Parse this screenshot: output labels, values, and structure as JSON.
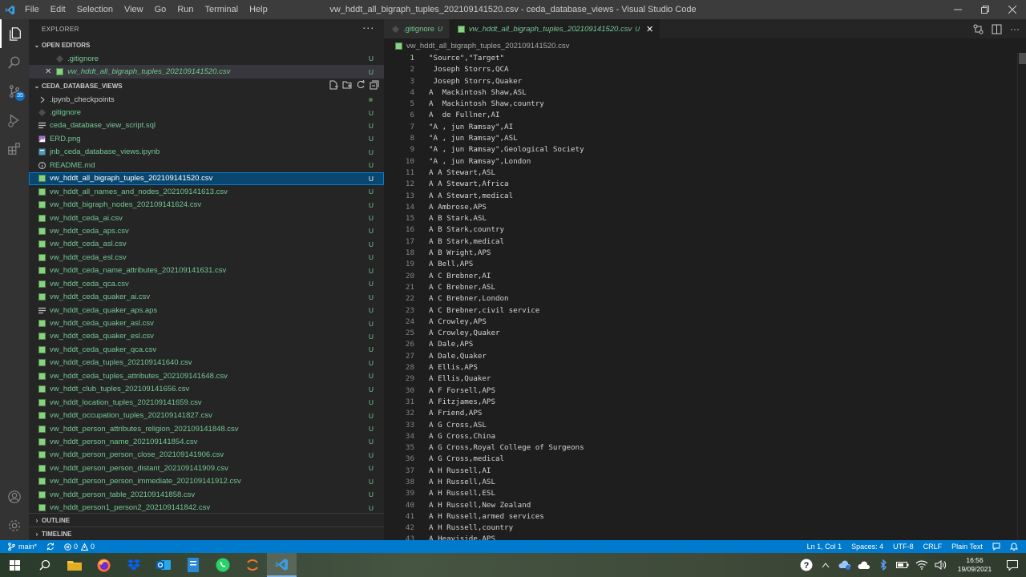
{
  "window": {
    "title": "vw_hddt_all_bigraph_tuples_202109141520.csv - ceda_database_views - Visual Studio Code"
  },
  "menu": [
    "File",
    "Edit",
    "Selection",
    "View",
    "Go",
    "Run",
    "Terminal",
    "Help"
  ],
  "activity_bar": {
    "source_control_badge": "35"
  },
  "explorer": {
    "header": "EXPLORER",
    "more": "···",
    "open_editors_label": "OPEN EDITORS",
    "open_editors": [
      {
        "name": ".gitignore",
        "status": "U"
      },
      {
        "name": "vw_hddt_all_bigraph_tuples_202109141520.csv",
        "status": "U"
      }
    ],
    "folder_label": "CEDA_DATABASE_VIEWS",
    "files": [
      {
        "name": ".ipynb_checkpoints",
        "status": "",
        "kind": "folder"
      },
      {
        "name": ".gitignore",
        "status": "U",
        "kind": "git"
      },
      {
        "name": "ceda_database_view_script.sql",
        "status": "U",
        "kind": "lines"
      },
      {
        "name": "ERD.png",
        "status": "U",
        "kind": "image"
      },
      {
        "name": "jnb_ceda_database_views.ipynb",
        "status": "U",
        "kind": "notebook"
      },
      {
        "name": "README.md",
        "status": "U",
        "kind": "info"
      },
      {
        "name": "vw_hddt_all_bigraph_tuples_202109141520.csv",
        "status": "U",
        "kind": "csv"
      },
      {
        "name": "vw_hddt_all_names_and_nodes_202109141613.csv",
        "status": "U",
        "kind": "csv"
      },
      {
        "name": "vw_hddt_bigraph_nodes_202109141624.csv",
        "status": "U",
        "kind": "csv"
      },
      {
        "name": "vw_hddt_ceda_ai.csv",
        "status": "U",
        "kind": "csv"
      },
      {
        "name": "vw_hddt_ceda_aps.csv",
        "status": "U",
        "kind": "csv"
      },
      {
        "name": "vw_hddt_ceda_asl.csv",
        "status": "U",
        "kind": "csv"
      },
      {
        "name": "vw_hddt_ceda_esl.csv",
        "status": "U",
        "kind": "csv"
      },
      {
        "name": "vw_hddt_ceda_name_attributes_202109141631.csv",
        "status": "U",
        "kind": "csv"
      },
      {
        "name": "vw_hddt_ceda_qca.csv",
        "status": "U",
        "kind": "csv"
      },
      {
        "name": "vw_hddt_ceda_quaker_ai.csv",
        "status": "U",
        "kind": "csv"
      },
      {
        "name": "vw_hddt_ceda_quaker_aps.aps",
        "status": "U",
        "kind": "lines"
      },
      {
        "name": "vw_hddt_ceda_quaker_asl.csv",
        "status": "U",
        "kind": "csv"
      },
      {
        "name": "vw_hddt_ceda_quaker_esl.csv",
        "status": "U",
        "kind": "csv"
      },
      {
        "name": "vw_hddt_ceda_quaker_qca.csv",
        "status": "U",
        "kind": "csv"
      },
      {
        "name": "vw_hddt_ceda_tuples_202109141640.csv",
        "status": "U",
        "kind": "csv"
      },
      {
        "name": "vw_hddt_ceda_tuples_attributes_202109141648.csv",
        "status": "U",
        "kind": "csv"
      },
      {
        "name": "vw_hddt_club_tuples_202109141656.csv",
        "status": "U",
        "kind": "csv"
      },
      {
        "name": "vw_hddt_location_tuples_202109141659.csv",
        "status": "U",
        "kind": "csv"
      },
      {
        "name": "vw_hddt_occupation_tuples_202109141827.csv",
        "status": "U",
        "kind": "csv"
      },
      {
        "name": "vw_hddt_person_attributes_religion_202109141848.csv",
        "status": "U",
        "kind": "csv"
      },
      {
        "name": "vw_hddt_person_name_202109141854.csv",
        "status": "U",
        "kind": "csv"
      },
      {
        "name": "vw_hddt_person_person_close_202109141906.csv",
        "status": "U",
        "kind": "csv"
      },
      {
        "name": "vw_hddt_person_person_distant_202109141909.csv",
        "status": "U",
        "kind": "csv"
      },
      {
        "name": "vw_hddt_person_person_immediate_202109141912.csv",
        "status": "U",
        "kind": "csv"
      },
      {
        "name": "vw_hddt_person_table_202109141858.csv",
        "status": "U",
        "kind": "csv"
      },
      {
        "name": "vw_hddt_person1_person2_202109141842.csv",
        "status": "U",
        "kind": "csv"
      }
    ],
    "outline_label": "OUTLINE",
    "timeline_label": "TIMELINE"
  },
  "tabs": [
    {
      "name": ".gitignore",
      "status": "U"
    },
    {
      "name": "vw_hddt_all_bigraph_tuples_202109141520.csv",
      "status": "U"
    }
  ],
  "breadcrumb": "vw_hddt_all_bigraph_tuples_202109141520.csv",
  "code_lines": [
    "\"Source\",\"Target\"",
    " Joseph Storrs,QCA",
    " Joseph Storrs,Quaker",
    "A  Mackintosh Shaw,ASL",
    "A  Mackintosh Shaw,country",
    "A  de Fullner,AI",
    "\"A , jun Ramsay\",AI",
    "\"A , jun Ramsay\",ASL",
    "\"A , jun Ramsay\",Geological Society",
    "\"A , jun Ramsay\",London",
    "A A Stewart,ASL",
    "A A Stewart,Africa",
    "A A Stewart,medical",
    "A Ambrose,APS",
    "A B Stark,ASL",
    "A B Stark,country",
    "A B Stark,medical",
    "A B Wright,APS",
    "A Bell,APS",
    "A C Brebner,AI",
    "A C Brebner,ASL",
    "A C Brebner,London",
    "A C Brebner,civil service",
    "A Crowley,APS",
    "A Crowley,Quaker",
    "A Dale,APS",
    "A Dale,Quaker",
    "A Ellis,APS",
    "A Ellis,Quaker",
    "A F Forsell,APS",
    "A Fitzjames,APS",
    "A Friend,APS",
    "A G Cross,ASL",
    "A G Cross,China",
    "A G Cross,Royal College of Surgeons",
    "A G Cross,medical",
    "A H Russell,AI",
    "A H Russell,ASL",
    "A H Russell,ESL",
    "A H Russell,New Zealand",
    "A H Russell,armed services",
    "A H Russell,country",
    "A Heaviside,APS"
  ],
  "status_bar": {
    "branch": "main*",
    "errors": "0",
    "warnings": "0",
    "position": "Ln 1, Col 1",
    "spaces": "Spaces: 4",
    "encoding": "UTF-8",
    "eol": "CRLF",
    "language": "Plain Text"
  },
  "taskbar": {
    "time": "16:56",
    "date": "19/09/2021"
  },
  "colors": {
    "accent": "#007acc",
    "untracked": "#73c991",
    "selection": "#094771"
  }
}
